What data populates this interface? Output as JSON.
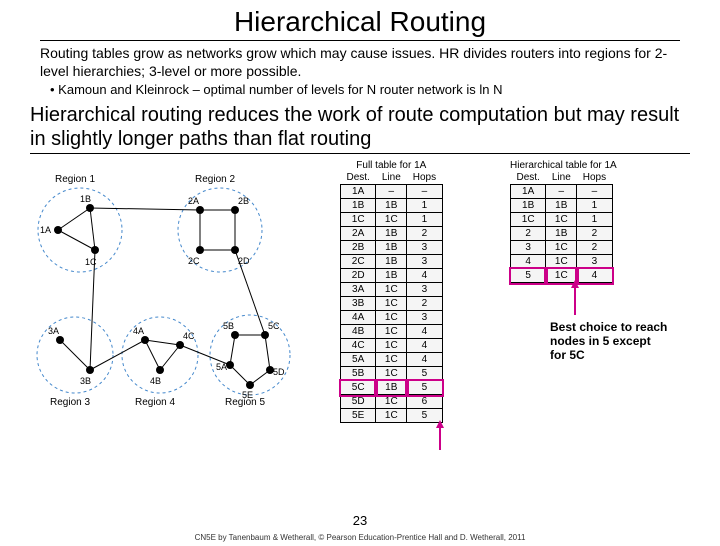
{
  "title": "Hierarchical Routing",
  "intro": "Routing tables grow as networks grow which may cause issues. HR divides routers into regions for 2-level hierarchies; 3-level or more possible.",
  "bullet1": "Kamoun and Kleinrock – optimal number of levels for N router network is ln N",
  "subheading": "Hierarchical routing reduces the work of route computation but may result in slightly longer paths than flat routing",
  "full_title": "Full table for 1A",
  "hier_title": "Hierarchical table for 1A",
  "col_dest": "Dest.",
  "col_line": "Line",
  "col_hops": "Hops",
  "regions": {
    "r1": "Region 1",
    "r2": "Region 2",
    "r3": "Region 3",
    "r4": "Region 4",
    "r5": "Region 5"
  },
  "full": [
    {
      "d": "1A",
      "l": "–",
      "h": "–"
    },
    {
      "d": "1B",
      "l": "1B",
      "h": "1"
    },
    {
      "d": "1C",
      "l": "1C",
      "h": "1"
    },
    {
      "d": "2A",
      "l": "1B",
      "h": "2"
    },
    {
      "d": "2B",
      "l": "1B",
      "h": "3"
    },
    {
      "d": "2C",
      "l": "1B",
      "h": "3"
    },
    {
      "d": "2D",
      "l": "1B",
      "h": "4"
    },
    {
      "d": "3A",
      "l": "1C",
      "h": "3"
    },
    {
      "d": "3B",
      "l": "1C",
      "h": "2"
    },
    {
      "d": "4A",
      "l": "1C",
      "h": "3"
    },
    {
      "d": "4B",
      "l": "1C",
      "h": "4"
    },
    {
      "d": "4C",
      "l": "1C",
      "h": "4"
    },
    {
      "d": "5A",
      "l": "1C",
      "h": "4"
    },
    {
      "d": "5B",
      "l": "1C",
      "h": "5"
    },
    {
      "d": "5C",
      "l": "1B",
      "h": "5"
    },
    {
      "d": "5D",
      "l": "1C",
      "h": "6"
    },
    {
      "d": "5E",
      "l": "1C",
      "h": "5"
    }
  ],
  "hier": [
    {
      "d": "1A",
      "l": "–",
      "h": "–"
    },
    {
      "d": "1B",
      "l": "1B",
      "h": "1"
    },
    {
      "d": "1C",
      "l": "1C",
      "h": "1"
    },
    {
      "d": "2",
      "l": "1B",
      "h": "2"
    },
    {
      "d": "3",
      "l": "1C",
      "h": "2"
    },
    {
      "d": "4",
      "l": "1C",
      "h": "3"
    },
    {
      "d": "5",
      "l": "1C",
      "h": "4"
    }
  ],
  "annotation": "Best choice to reach nodes in 5 except for 5C",
  "page": "23",
  "footer": "CN5E by Tanenbaum & Wetherall, © Pearson Education-Prentice Hall and D. Wetherall, 2011"
}
